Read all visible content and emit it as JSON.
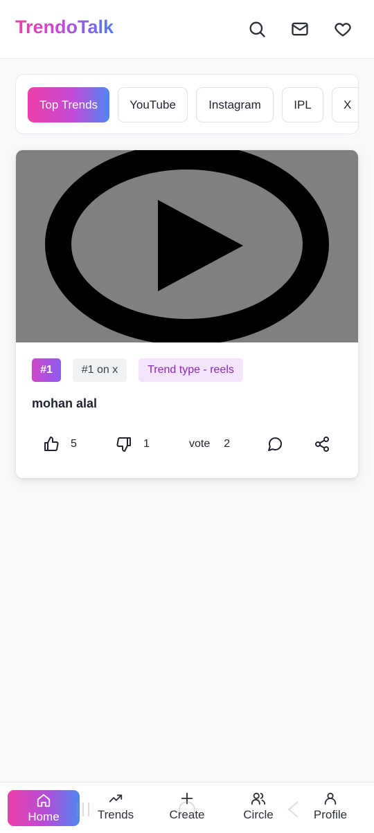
{
  "header": {
    "logo": "TrendoTalk",
    "icons": [
      "search-icon",
      "mail-icon",
      "heart-icon"
    ]
  },
  "categories": {
    "items": [
      {
        "label": "Top Trends",
        "active": true
      },
      {
        "label": "YouTube",
        "active": false
      },
      {
        "label": "Instagram",
        "active": false
      },
      {
        "label": "IPL",
        "active": false
      },
      {
        "label": "X",
        "active": false
      }
    ]
  },
  "post": {
    "media_icon": "play-circle-icon",
    "rank_badge": "#1",
    "source_badge": "#1 on x",
    "type_badge": "Trend type - reels",
    "title": "mohan alal",
    "likes": "5",
    "dislikes": "1",
    "vote_label": "vote",
    "votes": "2"
  },
  "bottom_nav": {
    "items": [
      {
        "label": "Home",
        "icon": "home-icon",
        "active": true
      },
      {
        "label": "Trends",
        "icon": "trending-up-icon",
        "active": false
      },
      {
        "label": "Create",
        "icon": "plus-icon",
        "active": false
      },
      {
        "label": "Circle",
        "icon": "users-icon",
        "active": false
      },
      {
        "label": "Profile",
        "icon": "user-icon",
        "active": false
      }
    ]
  },
  "colors": {
    "brand_pink": "#ec3fa8",
    "brand_purple": "#c44ad6",
    "brand_blue": "#4f7df0",
    "type_badge_bg": "#f4e4fb",
    "type_badge_text": "#8a2ab8"
  }
}
